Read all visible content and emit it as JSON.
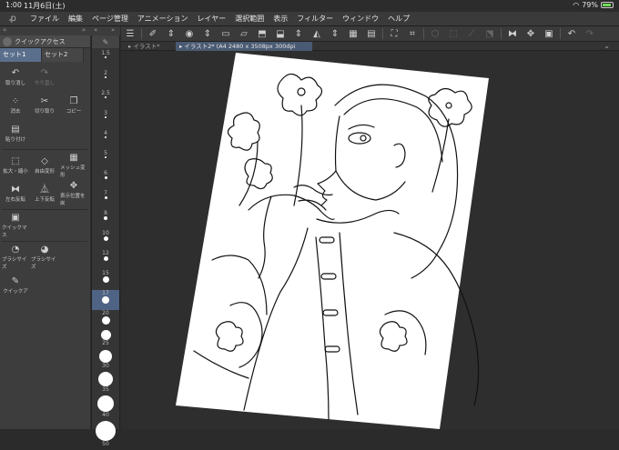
{
  "status": {
    "time": "1:00",
    "date": "11月6日(土)",
    "battery": "79%"
  },
  "menubar": {
    "items": [
      "ファイル",
      "編集",
      "ページ管理",
      "アニメーション",
      "レイヤー",
      "選択範囲",
      "表示",
      "フィルター",
      "ウィンドウ",
      "ヘルプ"
    ]
  },
  "quick_access": {
    "title": "クイックアクセス",
    "sets": [
      "セット1",
      "セット2"
    ],
    "commands": [
      {
        "label": "取り消し",
        "icon": "undo-icon",
        "glyph": "↶",
        "enabled": true
      },
      {
        "label": "やり直し",
        "icon": "redo-icon",
        "glyph": "↷",
        "enabled": false
      },
      {
        "label": "",
        "icon": "blank",
        "glyph": "",
        "enabled": false
      },
      {
        "label": "消去",
        "icon": "clear-icon",
        "glyph": "⁘",
        "enabled": true
      },
      {
        "label": "切り取り",
        "icon": "scissors-icon",
        "glyph": "✂",
        "enabled": true
      },
      {
        "label": "コピー",
        "icon": "copy-icon",
        "glyph": "❐",
        "enabled": true
      },
      {
        "label": "貼り付け",
        "icon": "paste-icon",
        "glyph": "▤",
        "enabled": true
      },
      {
        "label": "",
        "icon": "blank",
        "glyph": "",
        "enabled": false
      },
      {
        "label": "",
        "icon": "blank",
        "glyph": "",
        "enabled": false
      },
      {
        "label": "拡大・縮小",
        "icon": "scale-icon",
        "glyph": "⬚",
        "enabled": true
      },
      {
        "label": "自由変形",
        "icon": "free-transform-icon",
        "glyph": "◇",
        "enabled": true
      },
      {
        "label": "メッシュ変形",
        "icon": "mesh-transform-icon",
        "glyph": "▦",
        "enabled": true
      },
      {
        "label": "左右反転",
        "icon": "flip-horizontal-icon",
        "glyph": "⧓",
        "enabled": true
      },
      {
        "label": "上下反転",
        "icon": "flip-vertical-icon",
        "glyph": "⏅",
        "enabled": true
      },
      {
        "label": "表示位置を戻",
        "icon": "reset-view-icon",
        "glyph": "✥",
        "enabled": true
      },
      {
        "label": "クイックマス",
        "icon": "quick-mask-icon",
        "glyph": "▣",
        "enabled": true
      },
      {
        "label": "",
        "icon": "blank",
        "glyph": "",
        "enabled": false
      },
      {
        "label": "",
        "icon": "blank",
        "glyph": "",
        "enabled": false
      },
      {
        "label": "ブラシサイズ",
        "icon": "brush-size-down-icon",
        "glyph": "◔",
        "enabled": true
      },
      {
        "label": "ブラシサイズ",
        "icon": "brush-size-up-icon",
        "glyph": "◕",
        "enabled": true
      },
      {
        "label": "",
        "icon": "blank",
        "glyph": "",
        "enabled": false
      },
      {
        "label": "クイックア",
        "icon": "quick-access-tool-icon",
        "glyph": "✎",
        "enabled": true
      }
    ]
  },
  "brush_sizes": [
    "1.5",
    "2",
    "2.5",
    "3",
    "4",
    "5",
    "6",
    "7",
    "8",
    "10",
    "12",
    "15",
    "17",
    "20",
    "25",
    "30",
    "35",
    "40",
    "50"
  ],
  "brush_selected": "17",
  "tabs": [
    {
      "label": "イラスト*",
      "active": false
    },
    {
      "label": "イラスト2* (A4 2480 x 3508px 300dpi 39.0%)",
      "active": true
    }
  ],
  "colors": {
    "accent": "#4f6384",
    "background": "#2e2e2e",
    "panel": "#3d3d3d",
    "paper": "#ffffff"
  }
}
